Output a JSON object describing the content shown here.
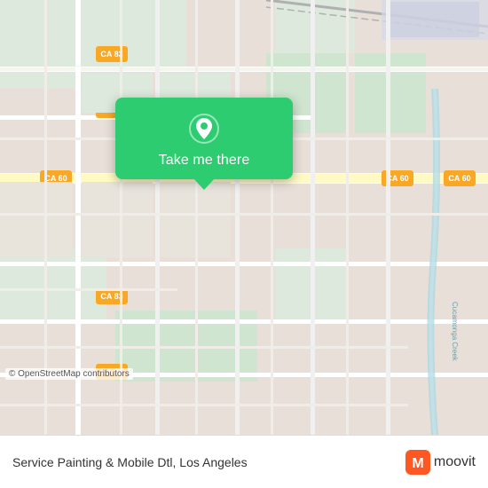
{
  "map": {
    "background_color": "#e8e0d8",
    "attribution": "© OpenStreetMap contributors"
  },
  "popup": {
    "label": "Take me there",
    "pin_icon": "location-pin-icon"
  },
  "bottom_bar": {
    "location_name": "Service Painting & Mobile Dtl, Los Angeles",
    "moovit_text": "moovit"
  }
}
